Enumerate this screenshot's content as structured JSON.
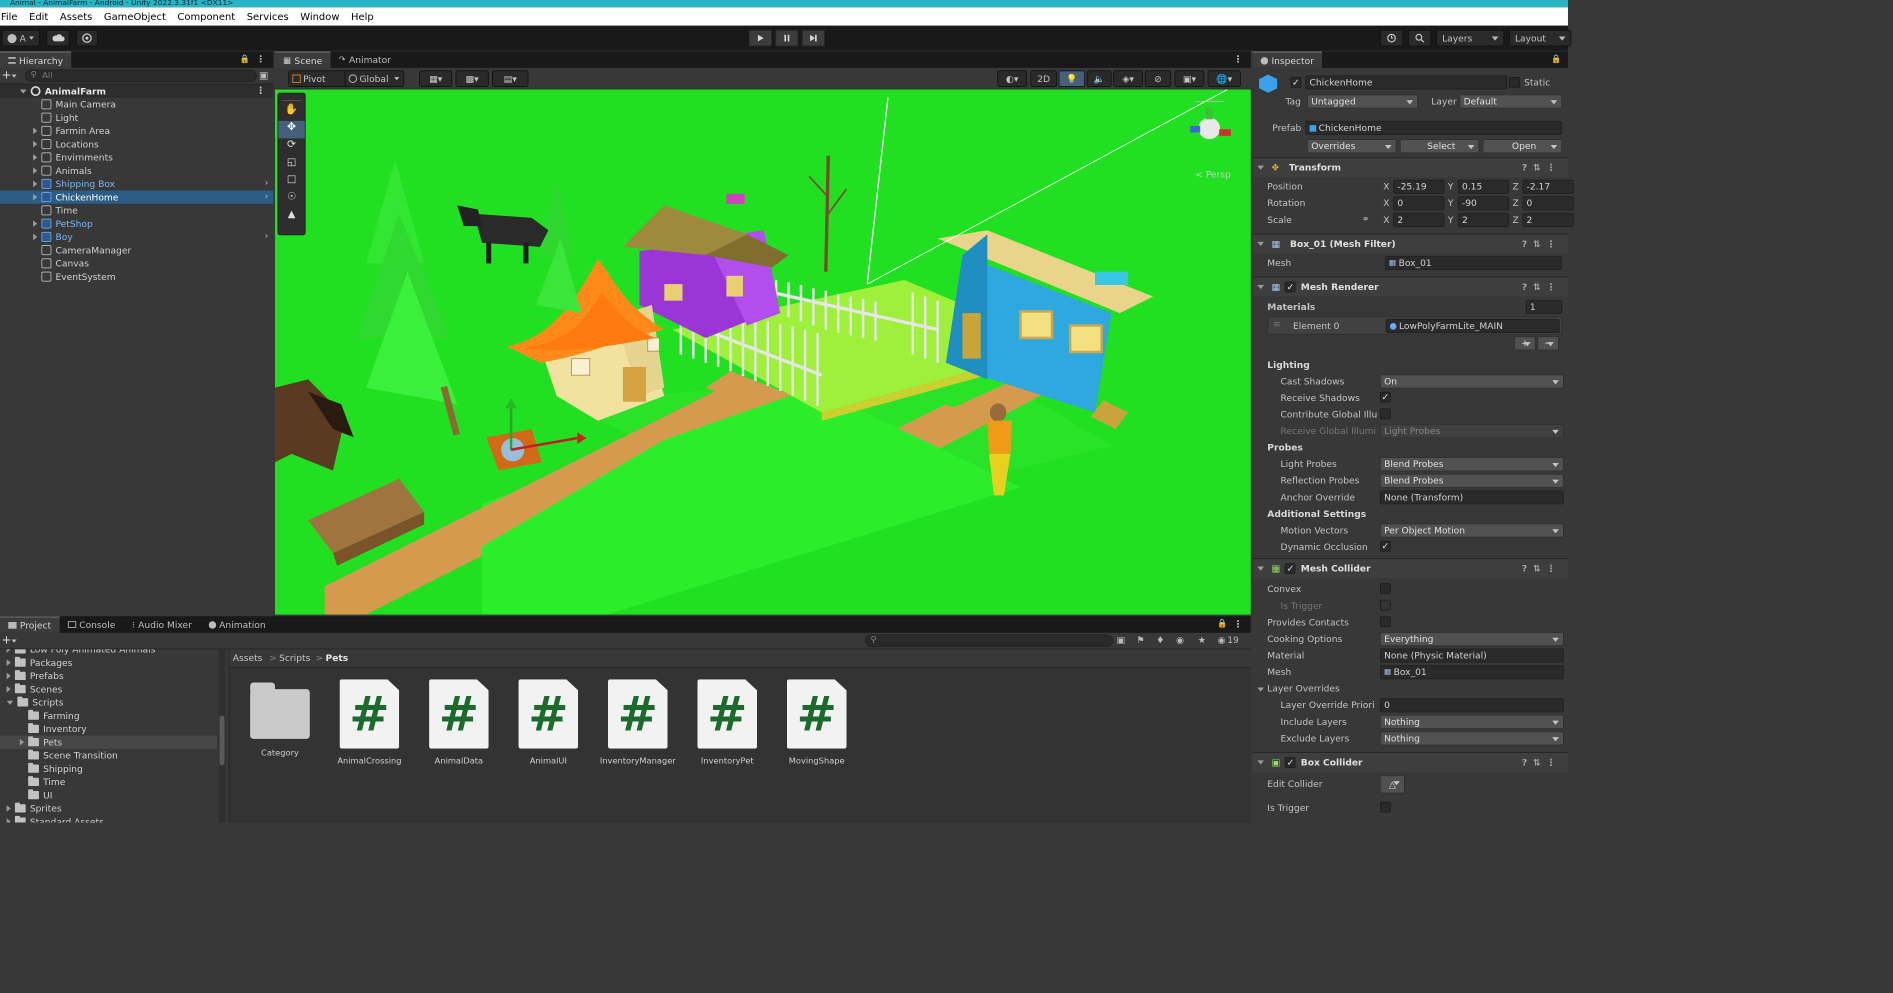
{
  "window": {
    "title": "Animal - AnimalFarm - Android - Unity 2022.3.31f1 <DX11>"
  },
  "menu": [
    "File",
    "Edit",
    "Assets",
    "GameObject",
    "Component",
    "Services",
    "Window",
    "Help"
  ],
  "toolbar": {
    "account": "A",
    "layers": "Layers",
    "layout": "Layout"
  },
  "hierarchy": {
    "tab": "Hierarchy",
    "search_placeholder": "All",
    "scene": "AnimalFarm",
    "items": [
      {
        "label": "Main Camera",
        "prefab": false
      },
      {
        "label": "Light",
        "prefab": false
      },
      {
        "label": "Farmin Area",
        "prefab": false
      },
      {
        "label": "Locations",
        "prefab": false
      },
      {
        "label": "Envirnments",
        "prefab": false
      },
      {
        "label": "Animals",
        "prefab": false
      },
      {
        "label": "Shipping Box",
        "prefab": true
      },
      {
        "label": "ChickenHome",
        "prefab": true,
        "selected": true
      },
      {
        "label": "Time",
        "prefab": false
      },
      {
        "label": "PetShop",
        "prefab": true
      },
      {
        "label": "Boy",
        "prefab": true
      },
      {
        "label": "CameraManager",
        "prefab": false
      },
      {
        "label": "Canvas",
        "prefab": false
      },
      {
        "label": "EventSystem",
        "prefab": false
      }
    ]
  },
  "scene_view": {
    "tabs": [
      "Scene",
      "Animator"
    ],
    "pivot": "Pivot",
    "global": "Global",
    "mode_2d": "2D",
    "persp": "< Persp"
  },
  "bottom_tabs": [
    "Project",
    "Console",
    "Audio Mixer",
    "Animation"
  ],
  "project": {
    "tree": [
      "Low Poly Animated Animals",
      "Packages",
      "Prefabs",
      "Scenes",
      "Scripts",
      "Farming",
      "Inventory",
      "Pets",
      "Scene Transition",
      "Shipping",
      "Time",
      "UI",
      "Sprites",
      "Standard Assets"
    ],
    "breadcrumb": [
      "Assets",
      "Scripts",
      "Pets"
    ],
    "hidden_count": "19",
    "assets": [
      {
        "name": "Category",
        "type": "folder"
      },
      {
        "name": "AnimalCrossing",
        "type": "script"
      },
      {
        "name": "AnimalData",
        "type": "script"
      },
      {
        "name": "AnimalUI",
        "type": "script"
      },
      {
        "name": "InventoryManager",
        "type": "script"
      },
      {
        "name": "InventoryPet",
        "type": "script"
      },
      {
        "name": "MovingShape",
        "type": "script"
      }
    ]
  },
  "inspector": {
    "tab": "Inspector",
    "object_name": "ChickenHome",
    "static_label": "Static",
    "tag_label": "Tag",
    "tag": "Untagged",
    "layer_label": "Layer",
    "layer": "Default",
    "prefab_label": "Prefab",
    "prefab": "ChickenHome",
    "overrides": "Overrides",
    "select": "Select",
    "open": "Open",
    "transform": {
      "title": "Transform",
      "position_label": "Position",
      "position": [
        "-25.19",
        "0.15",
        "-2.17"
      ],
      "rotation_label": "Rotation",
      "rotation": [
        "0",
        "-90",
        "0"
      ],
      "scale_label": "Scale",
      "scale": [
        "2",
        "2",
        "2"
      ]
    },
    "mesh_filter": {
      "title": "Box_01 (Mesh Filter)",
      "mesh_label": "Mesh",
      "mesh": "Box_01"
    },
    "mesh_renderer": {
      "title": "Mesh Renderer",
      "materials_label": "Materials",
      "materials_count": "1",
      "element_label": "Element 0",
      "element": "LowPolyFarmLite_MAIN",
      "lighting": "Lighting",
      "cast_shadows_label": "Cast Shadows",
      "cast_shadows": "On",
      "receive_shadows_label": "Receive Shadows",
      "contribute_gi_label": "Contribute Global Illu",
      "receive_gi_label": "Receive Global Illumi",
      "receive_gi": "Light Probes",
      "probes": "Probes",
      "light_probes_label": "Light Probes",
      "light_probes": "Blend Probes",
      "reflection_probes_label": "Reflection Probes",
      "reflection_probes": "Blend Probes",
      "anchor_override_label": "Anchor Override",
      "anchor_override": "None (Transform)",
      "additional": "Additional Settings",
      "motion_vectors_label": "Motion Vectors",
      "motion_vectors": "Per Object Motion",
      "dynamic_occlusion_label": "Dynamic Occlusion"
    },
    "mesh_collider": {
      "title": "Mesh Collider",
      "convex_label": "Convex",
      "is_trigger_label": "Is Trigger",
      "provides_contacts_label": "Provides Contacts",
      "cooking_options_label": "Cooking Options",
      "cooking_options": "Everything",
      "material_label": "Material",
      "material": "None (Physic Material)",
      "mesh_label": "Mesh",
      "mesh": "Box_01",
      "layer_overrides": "Layer Overrides",
      "layer_override_priority_label": "Layer Override Priori",
      "layer_override_priority": "0",
      "include_layers_label": "Include Layers",
      "include_layers": "Nothing",
      "exclude_layers_label": "Exclude Layers",
      "exclude_layers": "Nothing"
    },
    "box_collider": {
      "title": "Box Collider",
      "edit_collider_label": "Edit Collider",
      "is_trigger_label": "Is Trigger"
    }
  },
  "colors": {
    "accent": "#2c5d87",
    "title_bar": "#29b5c4",
    "scene_grass": "#21e021",
    "prefab_text": "#7cb9f5"
  }
}
